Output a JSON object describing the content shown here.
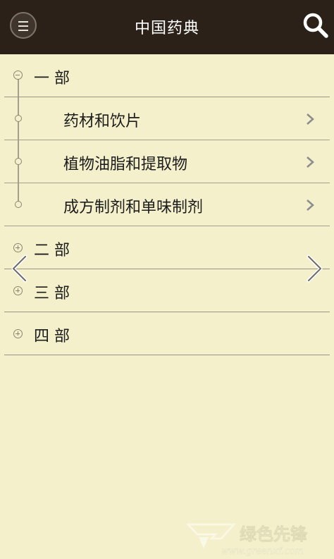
{
  "header": {
    "title": "中国药典",
    "background": "#2b2118"
  },
  "tree": {
    "sections": [
      {
        "label": "一 部",
        "expanded": true,
        "children": [
          {
            "label": "药材和饮片"
          },
          {
            "label": "植物油脂和提取物"
          },
          {
            "label": "成方制剂和单味制剂"
          }
        ]
      },
      {
        "label": "二 部",
        "expanded": false
      },
      {
        "label": "三 部",
        "expanded": false
      },
      {
        "label": "四 部",
        "expanded": false
      }
    ]
  },
  "watermark": {
    "text": "绿色先锋",
    "url": "www.greenxf.com"
  },
  "colors": {
    "page_background": "#f4f0cb",
    "divider": "#a59f90",
    "text": "#1c1c1c"
  }
}
